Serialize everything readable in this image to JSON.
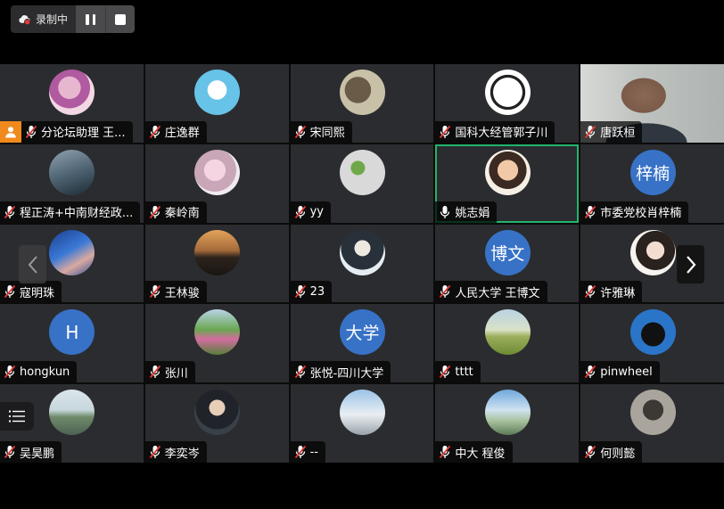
{
  "recording": {
    "status_text": "录制中",
    "icon": "cloud-record-icon",
    "pause_icon": "pause-icon",
    "stop_icon": "stop-icon",
    "accent": "#e53935"
  },
  "colors": {
    "tile_bg": "#2b2c2f",
    "active_border": "#21b56b",
    "host_badge": "#f08a1c",
    "text_avatar": "#3772c6",
    "muted_mic": "#e53935"
  },
  "participants": [
    {
      "name": "分论坛助理 王...",
      "avatar": "photo",
      "muted": true,
      "host": true
    },
    {
      "name": "庄逸群",
      "avatar": "photo",
      "muted": true
    },
    {
      "name": "宋同熙",
      "avatar": "photo",
      "muted": true
    },
    {
      "name": "国科大经管郭子川",
      "avatar": "photo",
      "muted": true
    },
    {
      "name": "唐跃桓",
      "avatar": "video",
      "muted": true
    },
    {
      "name": "程正涛+中南财经政...",
      "avatar": "photo",
      "muted": true
    },
    {
      "name": "秦岭南",
      "avatar": "photo",
      "muted": true
    },
    {
      "name": "yy",
      "avatar": "photo",
      "muted": true
    },
    {
      "name": "姚志娟",
      "avatar": "photo",
      "muted": false,
      "active": true
    },
    {
      "name": "市委党校肖梓楠",
      "avatar": "text",
      "avatar_text": "梓楠",
      "muted": true
    },
    {
      "name": "寇明珠",
      "avatar": "photo",
      "muted": true
    },
    {
      "name": "王林骏",
      "avatar": "photo",
      "muted": true
    },
    {
      "name": "23",
      "avatar": "photo",
      "muted": true
    },
    {
      "name": "人民大学 王博文",
      "avatar": "text",
      "avatar_text": "博文",
      "muted": true
    },
    {
      "name": "许雅琳",
      "avatar": "photo",
      "muted": true
    },
    {
      "name": "hongkun",
      "avatar": "text",
      "avatar_text": "H",
      "muted": true
    },
    {
      "name": "张川",
      "avatar": "photo",
      "muted": true
    },
    {
      "name": "张悦-四川大学",
      "avatar": "text",
      "avatar_text": "大学",
      "muted": true
    },
    {
      "name": "tttt",
      "avatar": "photo",
      "muted": true
    },
    {
      "name": "pinwheel",
      "avatar": "photo",
      "muted": true
    },
    {
      "name": "吴昊鹏",
      "avatar": "photo",
      "muted": true
    },
    {
      "name": "李奕岑",
      "avatar": "photo",
      "muted": true
    },
    {
      "name": "--",
      "avatar": "photo",
      "muted": true
    },
    {
      "name": "中大 程俊",
      "avatar": "photo",
      "muted": true
    },
    {
      "name": "何则懿",
      "avatar": "photo",
      "muted": true
    }
  ],
  "controls": {
    "prev_icon": "chevron-left-icon",
    "next_icon": "chevron-right-icon",
    "list_icon": "list-icon"
  }
}
